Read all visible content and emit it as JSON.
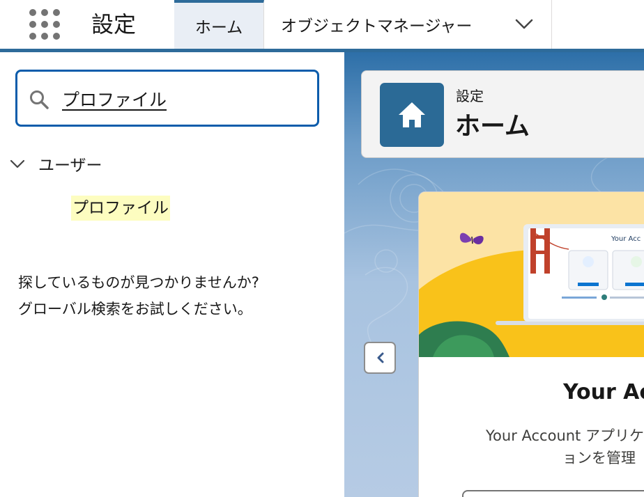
{
  "header": {
    "app_title": "設定",
    "tabs": [
      {
        "label": "ホーム"
      },
      {
        "label": "オブジェクトマネージャー"
      }
    ]
  },
  "sidebar": {
    "search_value": "プロファイル",
    "tree": {
      "parent_label": "ユーザー",
      "child_label": "プロファイル"
    },
    "hint_line1": "探しているものが見つかりませんか?",
    "hint_line2": "グローバル検索をお試しください。"
  },
  "main": {
    "page_subtitle": "設定",
    "page_title": "ホーム",
    "card": {
      "banner_text": "Your Acc",
      "title": "Your Ac",
      "desc_line1": "Your Account アプリケー",
      "desc_line2": "ョンを管理"
    }
  },
  "colors": {
    "accent": "#2e6b9a",
    "search_border": "#0b5cab",
    "highlight": "#fdfdc0",
    "header_icon_bg": "#2b6a96"
  },
  "icons": [
    "app-launcher-icon",
    "chevron-down-icon",
    "search-icon",
    "home-icon",
    "chevron-left-icon",
    "butterfly-icon"
  ]
}
